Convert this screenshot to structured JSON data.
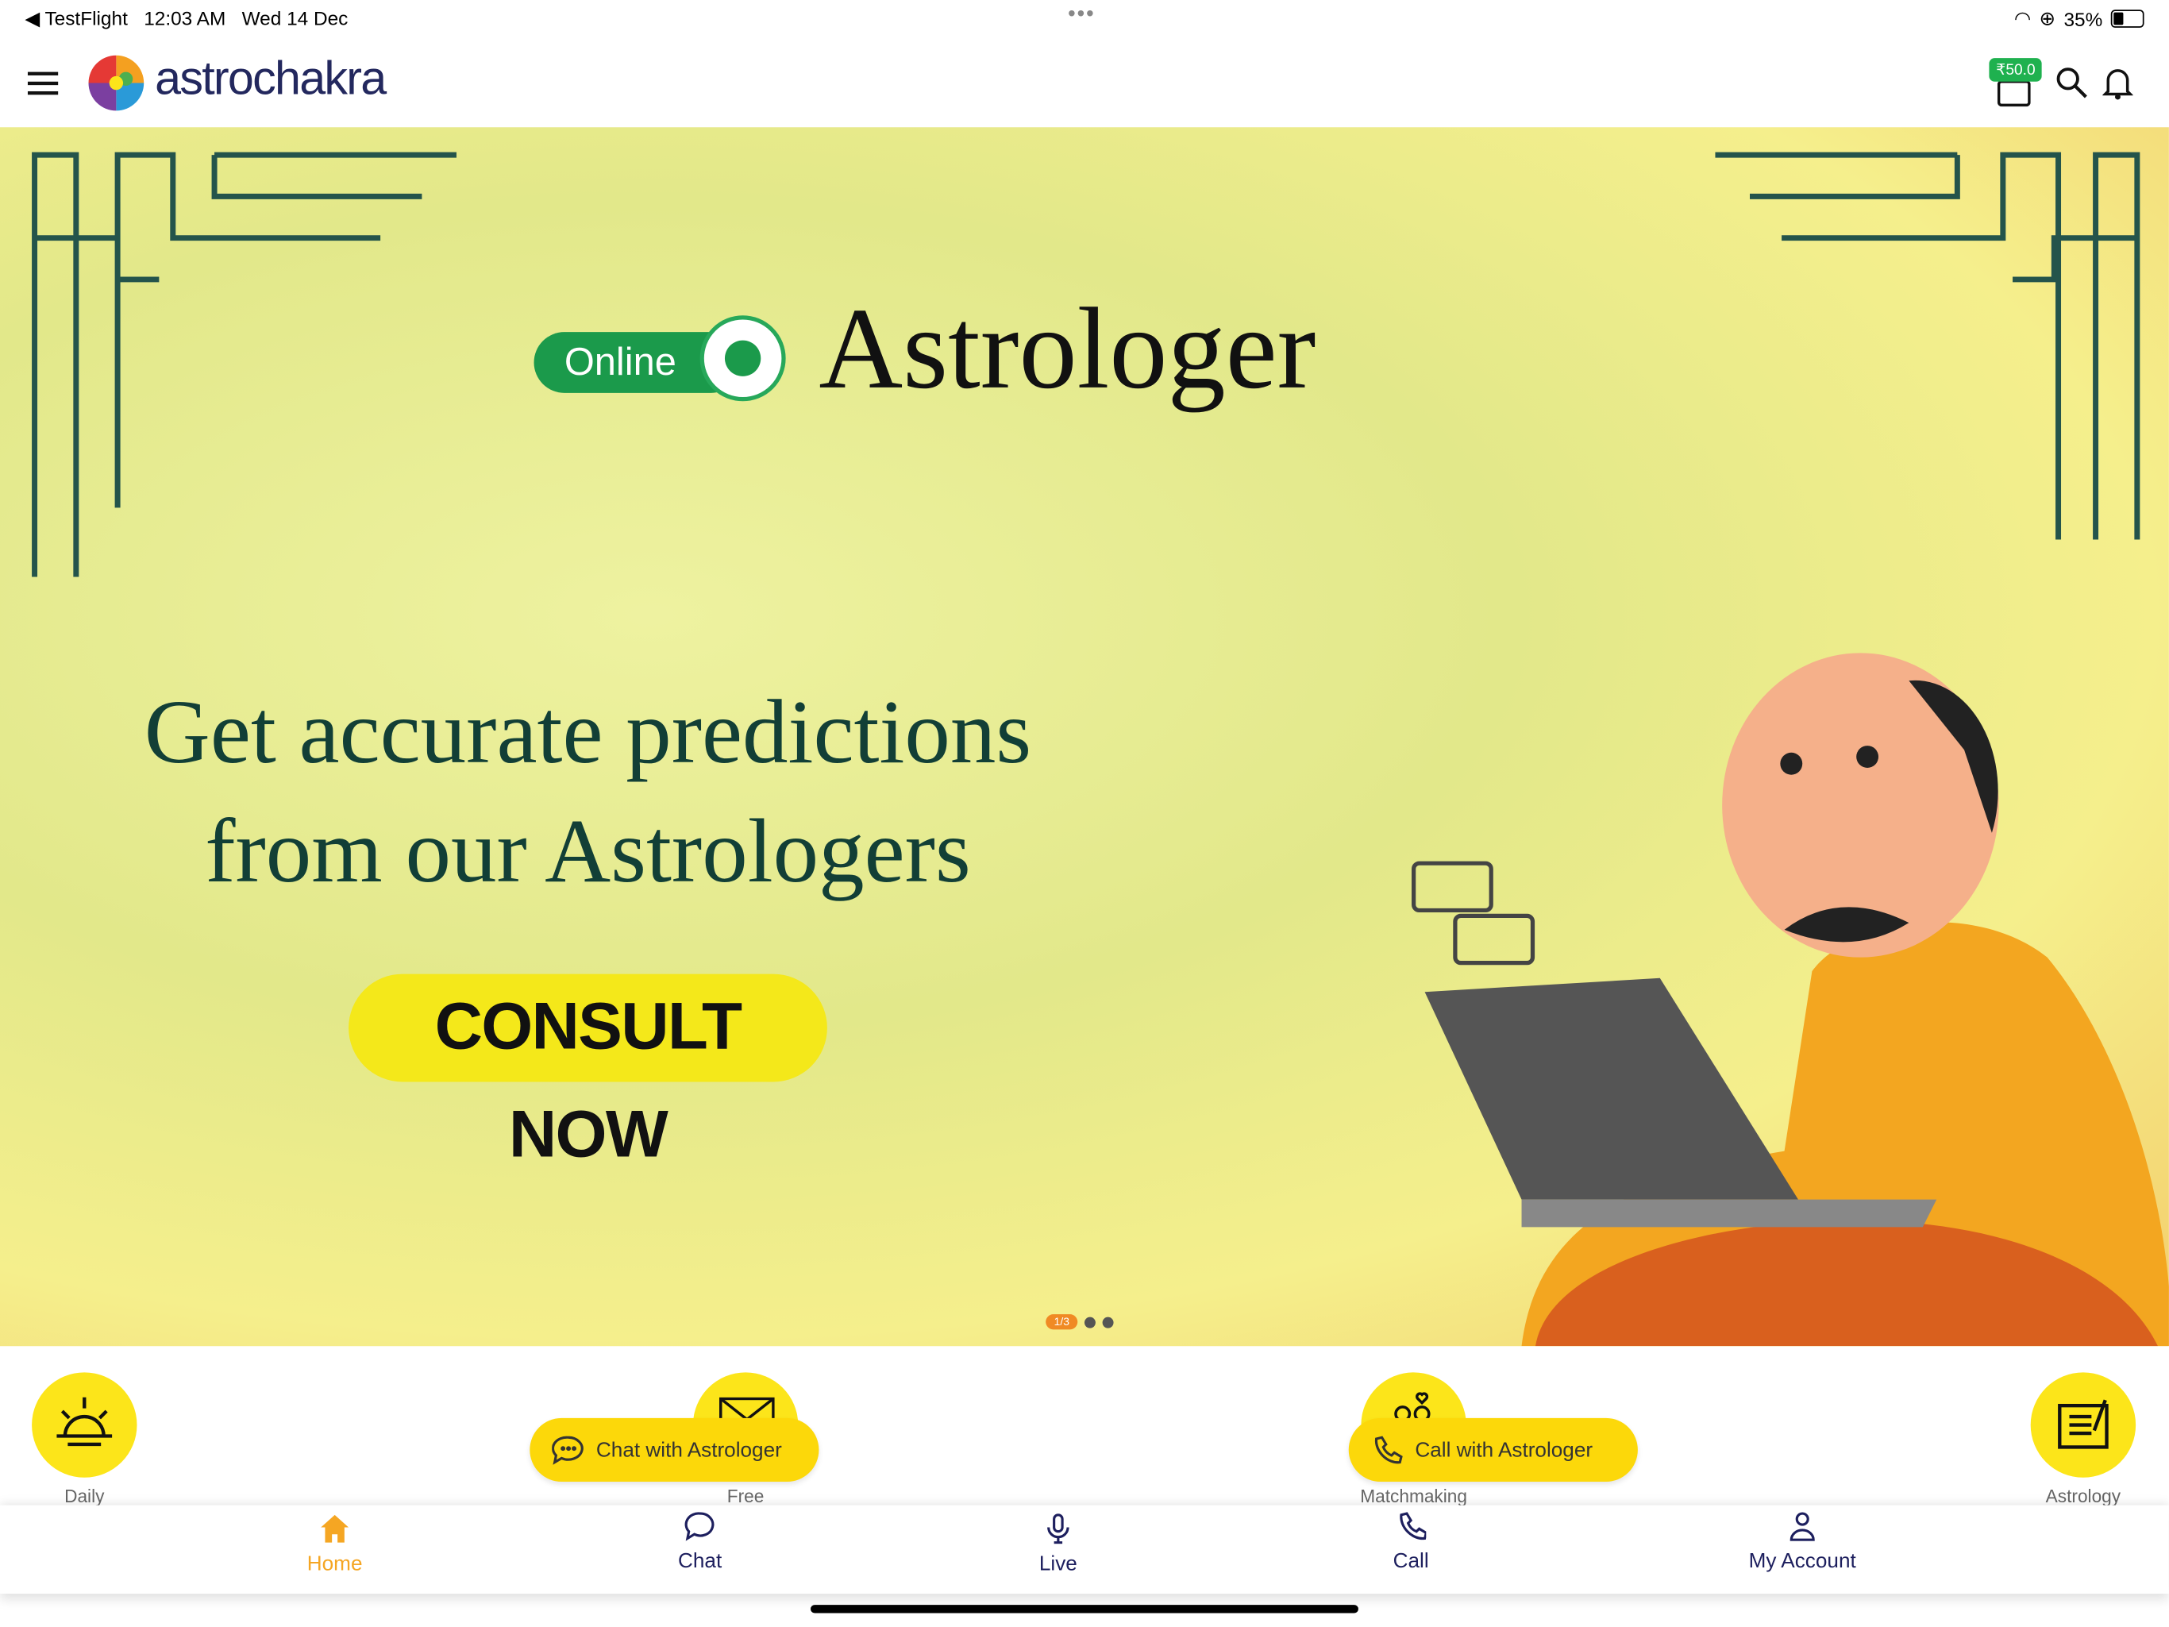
{
  "status_bar": {
    "back_app": "TestFlight",
    "time": "12:03 AM",
    "date": "Wed 14 Dec",
    "battery": "35%"
  },
  "header": {
    "logo": "astrochakra",
    "wallet_balance": "₹50.0"
  },
  "banner": {
    "online_badge": "Online",
    "title": "Astrologer",
    "headline_line1": "Get accurate predictions",
    "headline_line2": "from our Astrologers",
    "cta": "CONSULT NOW",
    "page_indicator": "1/3"
  },
  "categories": [
    {
      "label": "Daily",
      "icon": "sunrise-icon"
    },
    {
      "label": "Free",
      "icon": "kundli-chart-icon"
    },
    {
      "label": "Matchmaking",
      "icon": "couple-heart-icon"
    },
    {
      "label": "Astrology",
      "icon": "book-pen-icon"
    }
  ],
  "floating_buttons": {
    "chat": "Chat with Astrologer",
    "call": "Call with Astrologer"
  },
  "tabs": [
    {
      "label": "Home",
      "icon": "home-icon",
      "active": true
    },
    {
      "label": "Chat",
      "icon": "chat-icon"
    },
    {
      "label": "Live",
      "icon": "microphone-icon"
    },
    {
      "label": "Call",
      "icon": "phone-icon"
    },
    {
      "label": "My Account",
      "icon": "user-icon"
    }
  ],
  "colors": {
    "accent_yellow": "#fce51a",
    "active_tab": "#f5a623",
    "tab_text": "#1d1f5e",
    "brand_green": "#1b9a4b"
  }
}
